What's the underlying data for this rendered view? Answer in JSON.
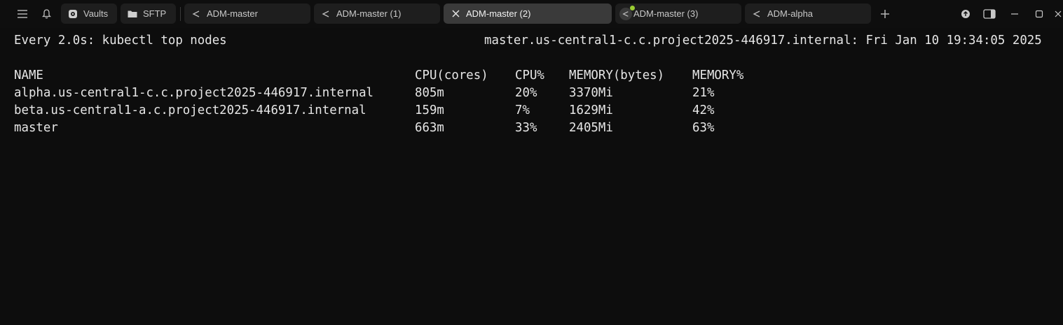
{
  "toolbar": {
    "menu_icon": "hamburger-menu-icon",
    "notifications_icon": "bell-icon"
  },
  "quick": [
    {
      "label": "Vaults",
      "icon": "vault-icon"
    },
    {
      "label": "SFTP",
      "icon": "folder-icon"
    }
  ],
  "tabs": [
    {
      "label": "ADM-master",
      "icon": "terminal-prompt-icon",
      "active": false
    },
    {
      "label": "ADM-master (1)",
      "icon": "terminal-prompt-icon",
      "active": false
    },
    {
      "label": "ADM-master (2)",
      "icon": "close-icon",
      "active": true
    },
    {
      "label": "ADM-master (3)",
      "icon": "terminal-prompt-icon",
      "active": false,
      "status_color": "#9acd32"
    },
    {
      "label": "ADM-alpha",
      "icon": "terminal-prompt-icon",
      "active": false
    }
  ],
  "window_controls": [
    "upload-icon",
    "sidebar-toggle-icon",
    "minimize-icon",
    "maximize-icon",
    "close-window-icon"
  ],
  "terminal": {
    "header_left": "Every 2.0s: kubectl top nodes",
    "header_right": "master.us-central1-c.c.project2025-446917.internal: Fri Jan 10 19:34:05 2025",
    "columns": [
      "NAME",
      "CPU(cores)",
      "CPU%",
      "MEMORY(bytes)",
      "MEMORY%"
    ],
    "rows": [
      [
        "alpha.us-central1-c.c.project2025-446917.internal",
        "805m",
        "20%",
        "3370Mi",
        "21%"
      ],
      [
        "beta.us-central1-a.c.project2025-446917.internal",
        "159m",
        "7%",
        "1629Mi",
        "42%"
      ],
      [
        "master",
        "663m",
        "33%",
        "2405Mi",
        "63%"
      ]
    ]
  },
  "colors": {
    "background": "#0d0d0d",
    "active_tab": "#3a3a3a",
    "tab": "#1e1e1e",
    "text": "#e6e6e6"
  }
}
